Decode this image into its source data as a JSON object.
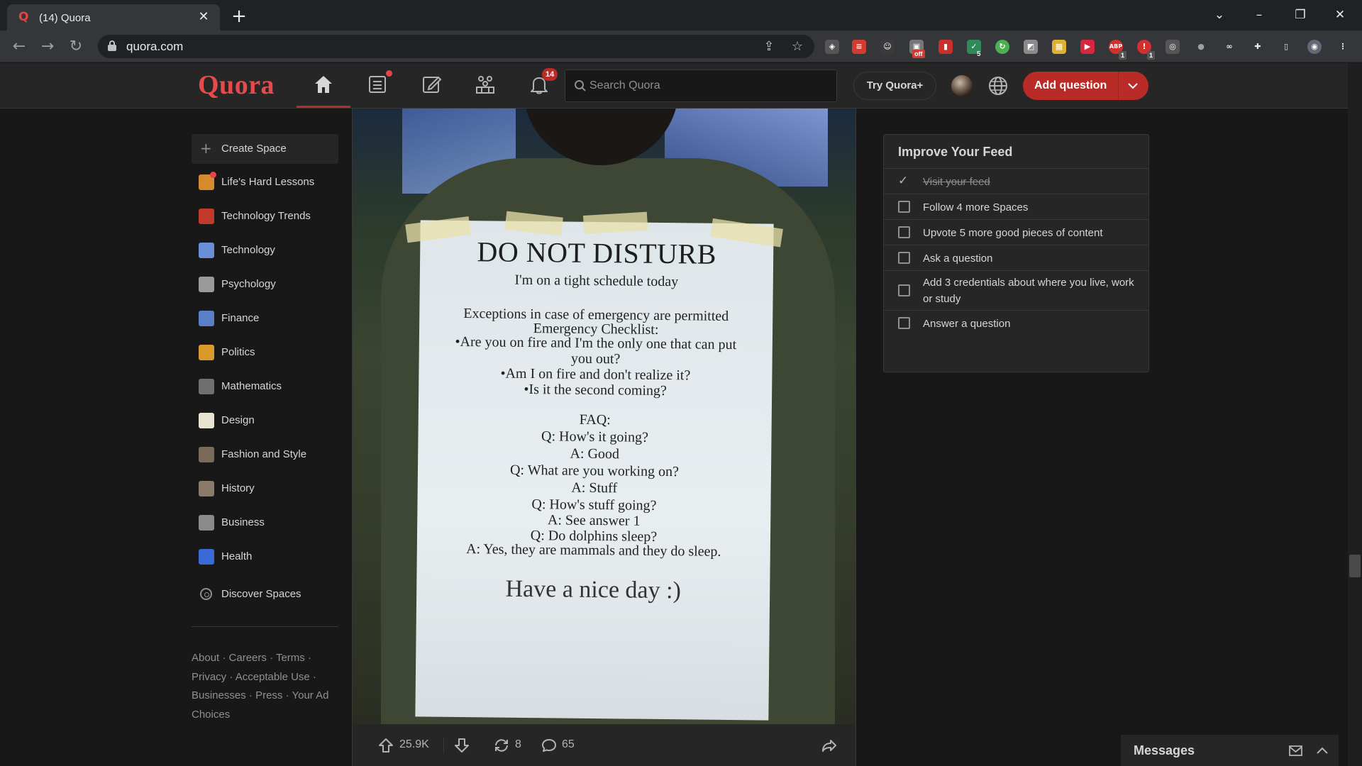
{
  "browser": {
    "tab_title": "(14) Quora",
    "url": "quora.com",
    "favicon": "quora-favicon",
    "extension_badges": {
      "off": "off",
      "ext5": "5",
      "abp": "1",
      "ext1": "1"
    }
  },
  "header": {
    "logo": "Quora",
    "notification_count": "14",
    "search_placeholder": "Search Quora",
    "try_plus": "Try Quora+",
    "add_question": "Add question",
    "accent_color": "#b92b27"
  },
  "sidebar": {
    "create_space": "Create Space",
    "spaces": [
      {
        "label": "Life's Hard Lessons",
        "color": "#d68a2e"
      },
      {
        "label": "Technology Trends",
        "color": "#c0392b"
      },
      {
        "label": "Technology",
        "color": "#6a8fd8"
      },
      {
        "label": "Psychology",
        "color": "#9a9a9a"
      },
      {
        "label": "Finance",
        "color": "#5a7fc8"
      },
      {
        "label": "Politics",
        "color": "#d89a2a"
      },
      {
        "label": "Mathematics",
        "color": "#6f6f6f"
      },
      {
        "label": "Design",
        "color": "#e8e2d0"
      },
      {
        "label": "Fashion and Style",
        "color": "#7a6a5a"
      },
      {
        "label": "History",
        "color": "#8a7a6a"
      },
      {
        "label": "Business",
        "color": "#8a8a8a"
      },
      {
        "label": "Health",
        "color": "#3a6ad8"
      }
    ],
    "discover": "Discover Spaces",
    "footer": [
      "About",
      "Careers",
      "Terms",
      "Privacy",
      "Acceptable Use",
      "Businesses",
      "Press",
      "Your Ad Choices"
    ]
  },
  "post": {
    "sign": {
      "title": "DO NOT DISTURB",
      "subtitle": "I'm on a tight schedule today",
      "lines": [
        "Exceptions in case of emergency are permitted",
        "Emergency Checklist:",
        "•Are you on fire and I'm the only one that can put",
        "you out?",
        "•Am I on fire and don't realize it?",
        "•Is it the second coming?",
        "FAQ:",
        "Q: How's it going?",
        "A: Good",
        "Q: What are you working on?",
        "A: Stuff",
        "Q: How's stuff going?",
        "A: See answer 1",
        "Q: Do dolphins sleep?",
        "A: Yes, they are mammals and they do sleep."
      ],
      "closing": "Have a nice day :)"
    },
    "upvotes": "25.9K",
    "shares": "8",
    "comments": "65"
  },
  "improve_feed": {
    "title": "Improve Your Feed",
    "tasks": [
      {
        "label": "Visit your feed",
        "done": true
      },
      {
        "label": "Follow 4 more Spaces",
        "done": false
      },
      {
        "label": "Upvote 5 more good pieces of content",
        "done": false
      },
      {
        "label": "Ask a question",
        "done": false
      },
      {
        "label": "Add 3 credentials about where you live, work or study",
        "done": false
      },
      {
        "label": "Answer a question",
        "done": false
      }
    ]
  },
  "messages": {
    "label": "Messages"
  }
}
